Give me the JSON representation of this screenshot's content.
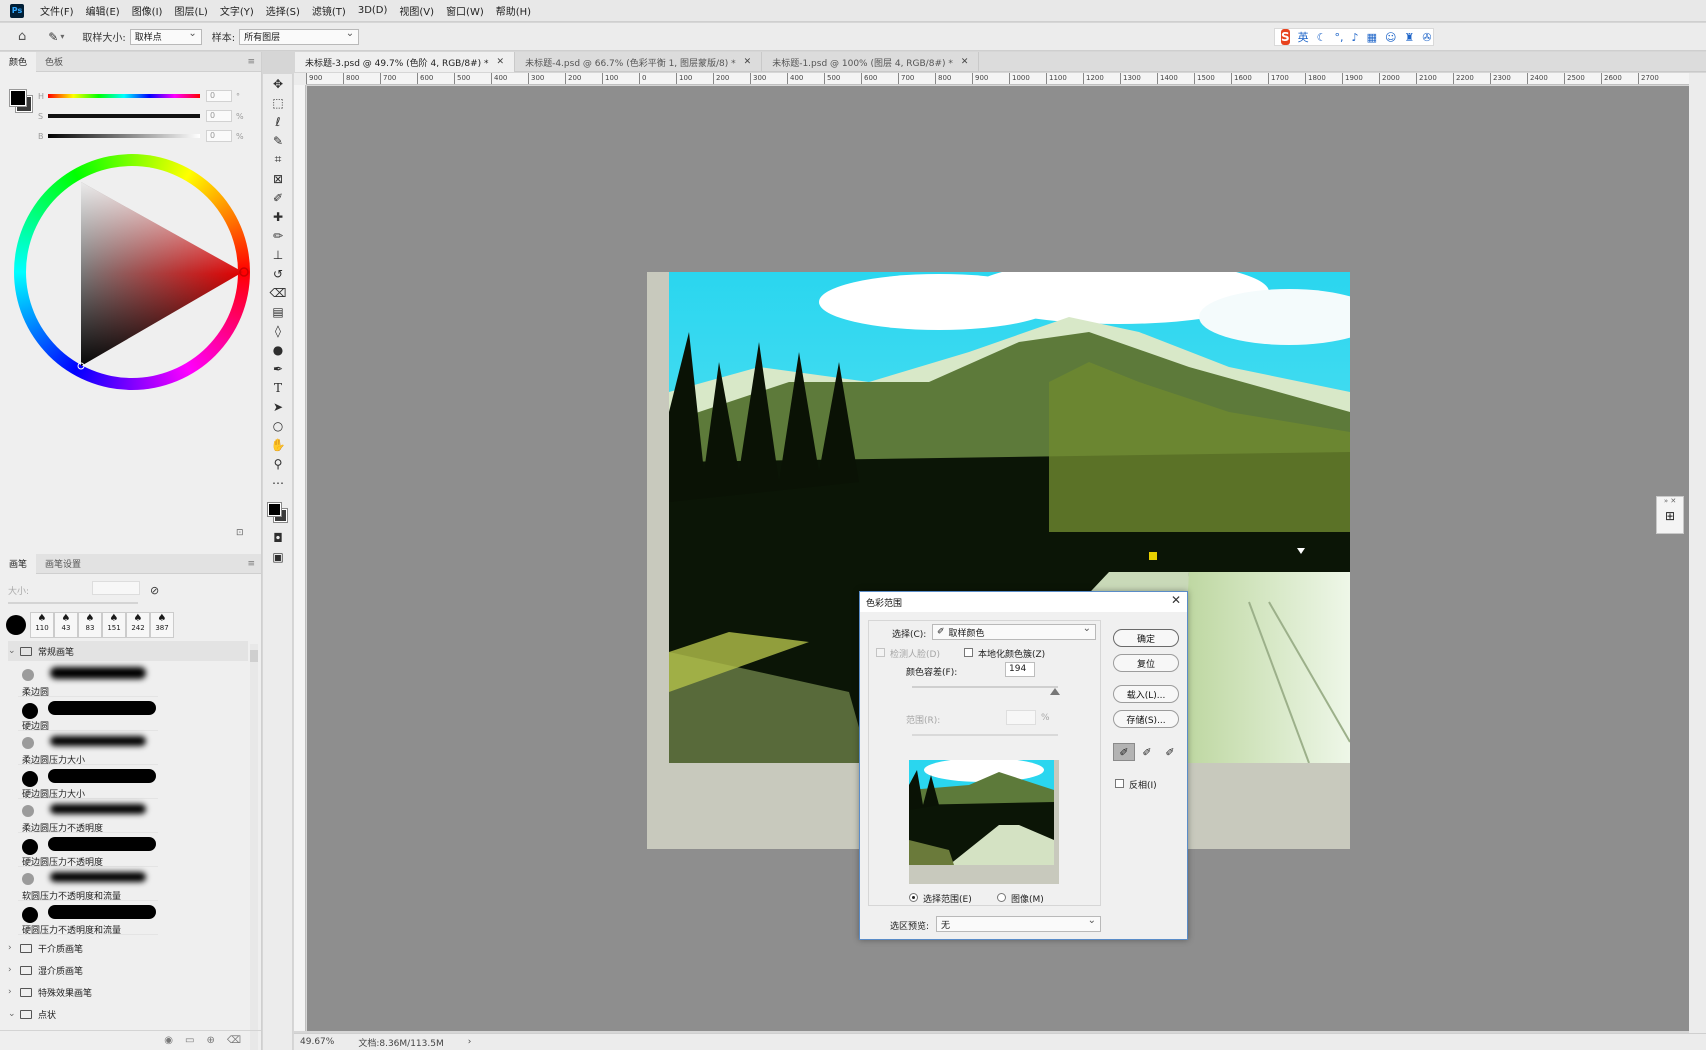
{
  "app": {
    "logo": "Ps"
  },
  "menu": [
    "文件(F)",
    "编辑(E)",
    "图像(I)",
    "图层(L)",
    "文字(Y)",
    "选择(S)",
    "滤镜(T)",
    "3D(D)",
    "视图(V)",
    "窗口(W)",
    "帮助(H)"
  ],
  "options": {
    "sample_size_label": "取样大小:",
    "sample_size_value": "取样点",
    "sample_label": "样本:",
    "sample_value": "所有图层"
  },
  "ime": {
    "lang": "英"
  },
  "color_panel": {
    "tabs": [
      "颜色",
      "色板"
    ],
    "h": {
      "key": "H",
      "value": "0",
      "unit": "°"
    },
    "s": {
      "key": "S",
      "value": "0",
      "unit": "%"
    },
    "b": {
      "key": "B",
      "value": "0",
      "unit": "%"
    }
  },
  "brush_panel": {
    "tabs": [
      "画笔",
      "画笔设置"
    ],
    "size_label": "大小:",
    "presets": [
      "110",
      "43",
      "83",
      "151",
      "242",
      "387"
    ],
    "group_open": "常规画笔",
    "brushes": [
      "柔边圆",
      "硬边圆",
      "柔边圆压力大小",
      "硬边圆压力大小",
      "柔边圆压力不透明度",
      "硬边圆压力不透明度",
      "软圆压力不透明度和流量",
      "硬圆压力不透明度和流量"
    ],
    "folders": [
      "干介质画笔",
      "湿介质画笔",
      "特殊效果画笔",
      "点状"
    ]
  },
  "doc_tabs": [
    {
      "label": "未标题-3.psd @ 49.7% (色阶 4, RGB/8#) *",
      "active": true
    },
    {
      "label": "未标题-4.psd @ 66.7% (色彩平衡 1, 图层蒙版/8) *",
      "active": false
    },
    {
      "label": "未标题-1.psd @ 100% (图层 4, RGB/8#) *",
      "active": false
    }
  ],
  "ruler_h": [
    "900",
    "800",
    "700",
    "600",
    "500",
    "400",
    "300",
    "200",
    "100",
    "0",
    "100",
    "200",
    "300",
    "400",
    "500",
    "600",
    "700",
    "800",
    "900",
    "1000",
    "1100",
    "1200",
    "1300",
    "1400",
    "1500",
    "1600",
    "1700",
    "1800",
    "1900",
    "2000",
    "2100",
    "2200",
    "2300",
    "2400",
    "2500",
    "2600",
    "2700"
  ],
  "dialog": {
    "title": "色彩范围",
    "select_label": "选择(C):",
    "select_value": "取样颜色",
    "detect_faces": "检测人脸(D)",
    "localized": "本地化颜色簇(Z)",
    "fuzziness_label": "颜色容差(F):",
    "fuzziness_value": "194",
    "range_label": "范围(R):",
    "range_unit": "%",
    "radio_selection": "选择范围(E)",
    "radio_image": "图像(M)",
    "preview_label": "选区预览:",
    "preview_value": "无",
    "btn_ok": "确定",
    "btn_reset": "复位",
    "btn_load": "载入(L)...",
    "btn_save": "存储(S)...",
    "invert": "反相(I)"
  },
  "status": {
    "zoom": "49.67%",
    "doc": "文档:8.36M/113.5M"
  }
}
